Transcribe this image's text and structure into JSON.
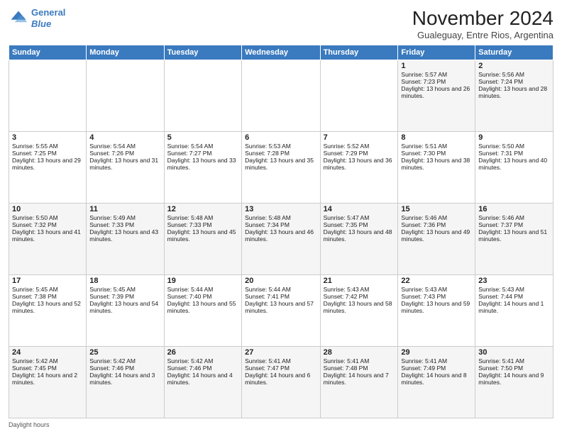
{
  "header": {
    "logo_line1": "General",
    "logo_line2": "Blue",
    "title": "November 2024",
    "subtitle": "Gualeguay, Entre Rios, Argentina"
  },
  "columns": [
    "Sunday",
    "Monday",
    "Tuesday",
    "Wednesday",
    "Thursday",
    "Friday",
    "Saturday"
  ],
  "weeks": [
    [
      {
        "day": "",
        "info": ""
      },
      {
        "day": "",
        "info": ""
      },
      {
        "day": "",
        "info": ""
      },
      {
        "day": "",
        "info": ""
      },
      {
        "day": "",
        "info": ""
      },
      {
        "day": "1",
        "info": "Sunrise: 5:57 AM\nSunset: 7:23 PM\nDaylight: 13 hours and 26 minutes."
      },
      {
        "day": "2",
        "info": "Sunrise: 5:56 AM\nSunset: 7:24 PM\nDaylight: 13 hours and 28 minutes."
      }
    ],
    [
      {
        "day": "3",
        "info": "Sunrise: 5:55 AM\nSunset: 7:25 PM\nDaylight: 13 hours and 29 minutes."
      },
      {
        "day": "4",
        "info": "Sunrise: 5:54 AM\nSunset: 7:26 PM\nDaylight: 13 hours and 31 minutes."
      },
      {
        "day": "5",
        "info": "Sunrise: 5:54 AM\nSunset: 7:27 PM\nDaylight: 13 hours and 33 minutes."
      },
      {
        "day": "6",
        "info": "Sunrise: 5:53 AM\nSunset: 7:28 PM\nDaylight: 13 hours and 35 minutes."
      },
      {
        "day": "7",
        "info": "Sunrise: 5:52 AM\nSunset: 7:29 PM\nDaylight: 13 hours and 36 minutes."
      },
      {
        "day": "8",
        "info": "Sunrise: 5:51 AM\nSunset: 7:30 PM\nDaylight: 13 hours and 38 minutes."
      },
      {
        "day": "9",
        "info": "Sunrise: 5:50 AM\nSunset: 7:31 PM\nDaylight: 13 hours and 40 minutes."
      }
    ],
    [
      {
        "day": "10",
        "info": "Sunrise: 5:50 AM\nSunset: 7:32 PM\nDaylight: 13 hours and 41 minutes."
      },
      {
        "day": "11",
        "info": "Sunrise: 5:49 AM\nSunset: 7:33 PM\nDaylight: 13 hours and 43 minutes."
      },
      {
        "day": "12",
        "info": "Sunrise: 5:48 AM\nSunset: 7:33 PM\nDaylight: 13 hours and 45 minutes."
      },
      {
        "day": "13",
        "info": "Sunrise: 5:48 AM\nSunset: 7:34 PM\nDaylight: 13 hours and 46 minutes."
      },
      {
        "day": "14",
        "info": "Sunrise: 5:47 AM\nSunset: 7:35 PM\nDaylight: 13 hours and 48 minutes."
      },
      {
        "day": "15",
        "info": "Sunrise: 5:46 AM\nSunset: 7:36 PM\nDaylight: 13 hours and 49 minutes."
      },
      {
        "day": "16",
        "info": "Sunrise: 5:46 AM\nSunset: 7:37 PM\nDaylight: 13 hours and 51 minutes."
      }
    ],
    [
      {
        "day": "17",
        "info": "Sunrise: 5:45 AM\nSunset: 7:38 PM\nDaylight: 13 hours and 52 minutes."
      },
      {
        "day": "18",
        "info": "Sunrise: 5:45 AM\nSunset: 7:39 PM\nDaylight: 13 hours and 54 minutes."
      },
      {
        "day": "19",
        "info": "Sunrise: 5:44 AM\nSunset: 7:40 PM\nDaylight: 13 hours and 55 minutes."
      },
      {
        "day": "20",
        "info": "Sunrise: 5:44 AM\nSunset: 7:41 PM\nDaylight: 13 hours and 57 minutes."
      },
      {
        "day": "21",
        "info": "Sunrise: 5:43 AM\nSunset: 7:42 PM\nDaylight: 13 hours and 58 minutes."
      },
      {
        "day": "22",
        "info": "Sunrise: 5:43 AM\nSunset: 7:43 PM\nDaylight: 13 hours and 59 minutes."
      },
      {
        "day": "23",
        "info": "Sunrise: 5:43 AM\nSunset: 7:44 PM\nDaylight: 14 hours and 1 minute."
      }
    ],
    [
      {
        "day": "24",
        "info": "Sunrise: 5:42 AM\nSunset: 7:45 PM\nDaylight: 14 hours and 2 minutes."
      },
      {
        "day": "25",
        "info": "Sunrise: 5:42 AM\nSunset: 7:46 PM\nDaylight: 14 hours and 3 minutes."
      },
      {
        "day": "26",
        "info": "Sunrise: 5:42 AM\nSunset: 7:46 PM\nDaylight: 14 hours and 4 minutes."
      },
      {
        "day": "27",
        "info": "Sunrise: 5:41 AM\nSunset: 7:47 PM\nDaylight: 14 hours and 6 minutes."
      },
      {
        "day": "28",
        "info": "Sunrise: 5:41 AM\nSunset: 7:48 PM\nDaylight: 14 hours and 7 minutes."
      },
      {
        "day": "29",
        "info": "Sunrise: 5:41 AM\nSunset: 7:49 PM\nDaylight: 14 hours and 8 minutes."
      },
      {
        "day": "30",
        "info": "Sunrise: 5:41 AM\nSunset: 7:50 PM\nDaylight: 14 hours and 9 minutes."
      }
    ]
  ],
  "footer": {
    "daylight_label": "Daylight hours"
  }
}
